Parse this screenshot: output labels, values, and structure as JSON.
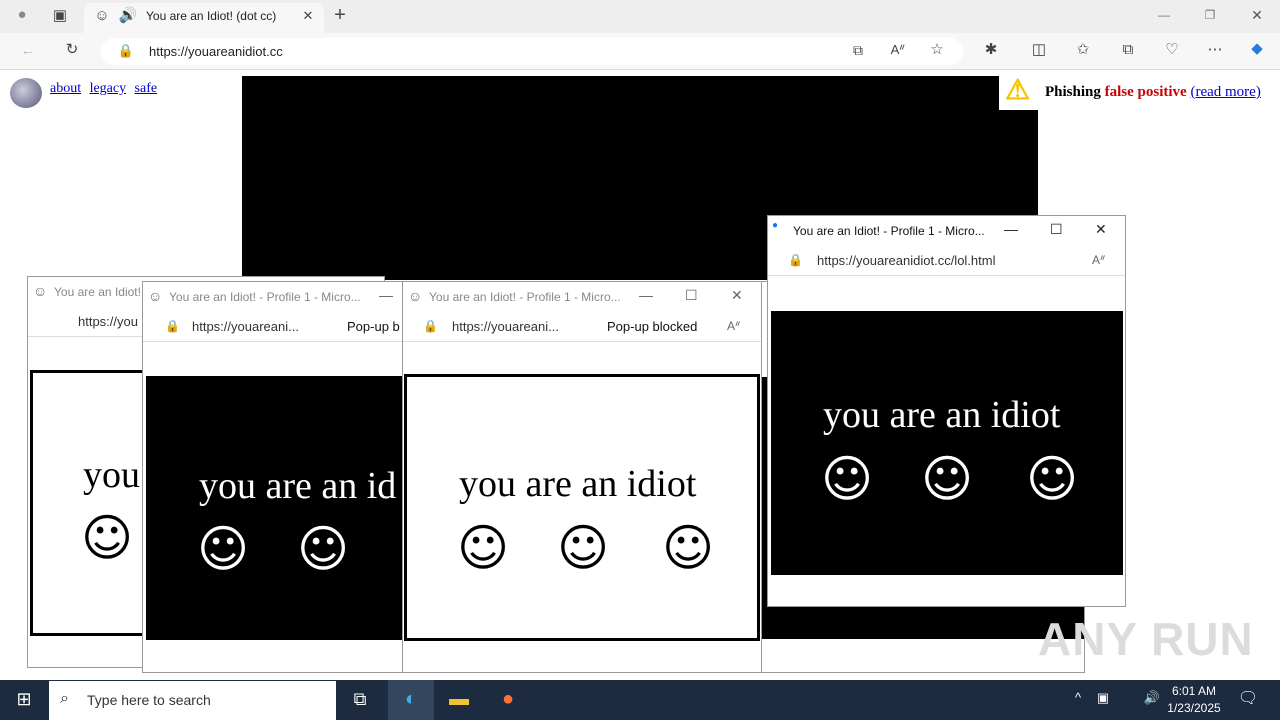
{
  "browser": {
    "tab_title": "You are an Idiot! (dot cc)",
    "url": "https://youareanidiot.cc",
    "new_tab": "+",
    "window_min": "—",
    "window_restore": "❐",
    "window_close": "✕"
  },
  "page": {
    "links": [
      "about",
      "legacy",
      "safe"
    ],
    "phishing": {
      "word1": "Phishing",
      "word2": "false positive",
      "link": "(read more)"
    }
  },
  "popups": [
    {
      "title": "You are an Idiot!",
      "url": "https://you",
      "text": "you",
      "box": "white"
    },
    {
      "title": "You are an Idiot! - Profile 1 - Micro...",
      "url": "https://youareani...",
      "blocked": "Pop-up b",
      "text": "you are an id",
      "box": "black"
    },
    {
      "title": "You are an Idiot! - Profile 1 - Micro...",
      "url": "https://youareani...",
      "blocked": "Pop-up blocked",
      "text": "you are an idiot",
      "box": "white"
    },
    {
      "title": "You are an Idiot! - Profile 1 - Micro...",
      "url": "https://youareanidiot.cc/lol.html",
      "text": "you are an idiot",
      "box": "black"
    }
  ],
  "taskbar": {
    "search_placeholder": "Type here to search",
    "time": "6:01 AM",
    "date": "1/23/2025"
  },
  "watermark": "ANY RUN",
  "colors": {
    "taskbar": "#1c2b3f",
    "link": "#0000cc",
    "phish_red": "#cc0000"
  }
}
